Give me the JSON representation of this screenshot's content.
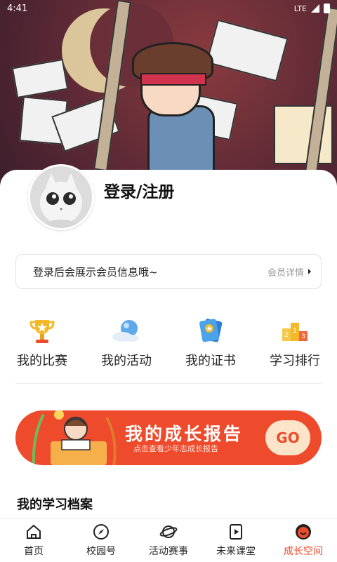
{
  "status": {
    "time": "4:41",
    "network": "LTE"
  },
  "profile": {
    "login_title": "登录/注册"
  },
  "membership": {
    "text": "登录后会展示会员信息哦~",
    "link": "会员详情"
  },
  "shortcuts": [
    {
      "label": "我的比赛",
      "icon": "trophy-icon"
    },
    {
      "label": "我的活动",
      "icon": "cloud-ball-icon"
    },
    {
      "label": "我的证书",
      "icon": "certificate-icon"
    },
    {
      "label": "学习排行",
      "icon": "podium-icon"
    }
  ],
  "banner": {
    "title": "我的成长报告",
    "subtitle": "点击查看少年志成长报告",
    "go": "GO"
  },
  "archive": {
    "title": "我的学习档案"
  },
  "nav": [
    {
      "label": "首页",
      "icon": "home-icon"
    },
    {
      "label": "校园号",
      "icon": "compass-icon"
    },
    {
      "label": "活动赛事",
      "icon": "planet-icon"
    },
    {
      "label": "未来课堂",
      "icon": "play-icon"
    },
    {
      "label": "成长空间",
      "icon": "smile-icon",
      "active": true
    }
  ],
  "colors": {
    "accent": "#ee4a2c",
    "hero": "#5e2a36"
  }
}
